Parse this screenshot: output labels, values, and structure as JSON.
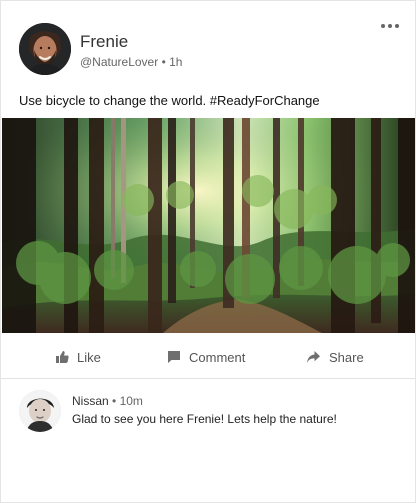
{
  "post": {
    "author": "Frenie",
    "handle": "@NatureLover",
    "separator": "•",
    "time": "1h",
    "text": "Use bicycle to change the world. #ReadyForChange",
    "image_alt": "Forest"
  },
  "actions": {
    "like": "Like",
    "comment": "Comment",
    "share": "Share"
  },
  "comment": {
    "author": "Nissan",
    "separator": "•",
    "time": "10m",
    "text": "Glad to see you here Frenie! Lets help the nature!"
  },
  "icons": {
    "more": "more-horizontal-icon",
    "like": "thumbs-up-icon",
    "comment": "comment-icon",
    "share": "share-arrow-icon"
  },
  "colors": {
    "icon": "#6f6f6f",
    "text": "#222222",
    "muted": "#666666",
    "divider": "#e3e3e3"
  }
}
